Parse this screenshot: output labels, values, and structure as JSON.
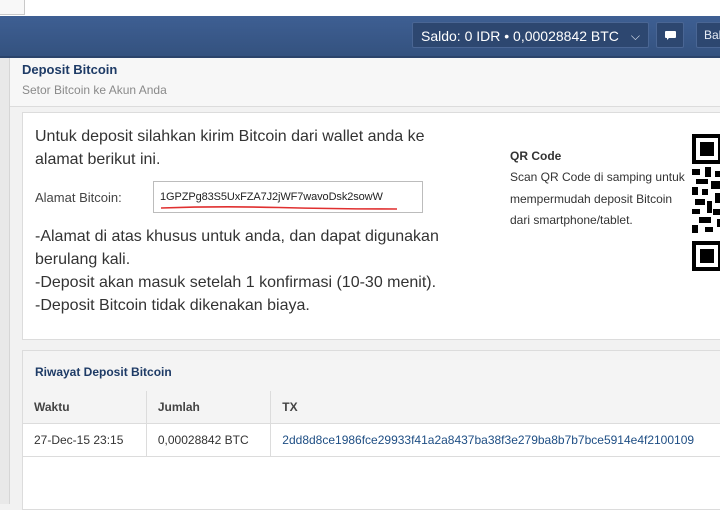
{
  "navbar": {
    "saldo_text": "Saldo:  0 IDR  •  0,00028842 BTC",
    "bah_label": "Bah",
    "chevron_icon": "chevron-down-icon",
    "chat_icon": "chat-bubble-icon"
  },
  "page": {
    "title": "Deposit Bitcoin",
    "subtitle": "Setor Bitcoin ke Akun Anda"
  },
  "deposit": {
    "intro": "Untuk deposit silahkan kirim Bitcoin dari wallet anda ke alamat berikut ini.",
    "address_label": "Alamat Bitcoin:",
    "address_value": "1GPZPg83S5UxFZA7J2jWF7wavoDsk2sowW",
    "notes": [
      "-Alamat di atas khusus untuk anda, dan dapat digunakan berulang kali.",
      "-Deposit akan masuk setelah 1 konfirmasi (10-30 menit).",
      "-Deposit Bitcoin tidak dikenakan biaya."
    ],
    "qr_title": "QR Code",
    "qr_text": "Scan QR Code di samping untuk mempermudah deposit Bitcoin dari smartphone/tablet."
  },
  "history": {
    "title": "Riwayat Deposit Bitcoin",
    "columns": [
      "Waktu",
      "Jumlah",
      "TX"
    ],
    "rows": [
      {
        "time": "27-Dec-15 23:15",
        "amount": "0,00028842 BTC",
        "tx": "2dd8d8ce1986fce29933f41a2a8437ba38f3e279ba8b7b7bce5914e4f2100109"
      }
    ]
  },
  "colors": {
    "navbar": "#3a5a8c",
    "title": "#1e3b66",
    "link": "#1e4e84",
    "annotation_underline": "#e03030"
  }
}
